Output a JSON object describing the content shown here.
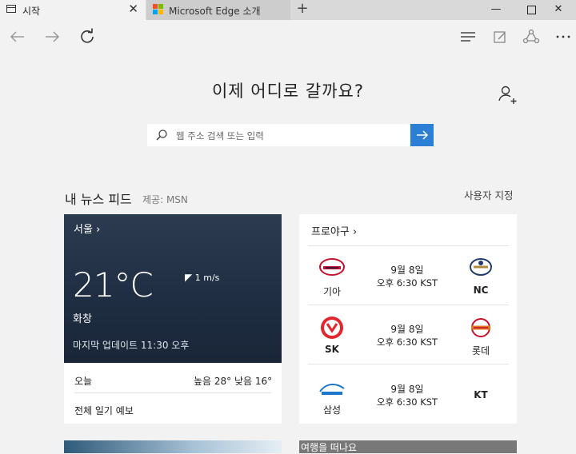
{
  "tabs": [
    {
      "label": "시작",
      "icon": "start-page-icon"
    },
    {
      "label": "Microsoft Edge 소개",
      "icon": "windows-logo-icon"
    }
  ],
  "window_controls": [
    "minimize",
    "maximize",
    "close"
  ],
  "start": {
    "heading": "이제 어디로 갈까요?",
    "search_placeholder": "웹 주소 검색 또는 입력"
  },
  "feed": {
    "title": "내 뉴스 피드",
    "provider": "제공: MSN",
    "customize": "사용자 지정"
  },
  "weather": {
    "city": "서울",
    "temperature": "21°C",
    "wind": "1 m/s",
    "condition": "화창",
    "updated": "마지막 업데이트 11:30 오후",
    "today_label": "오늘",
    "high_low": "높음 28° 낮음 16°",
    "forecast_link": "전체 일기 예보"
  },
  "baseball": {
    "title": "프로야구",
    "games": [
      {
        "home": "기아",
        "away": "NC",
        "date": "9월 8일",
        "time": "오후 6:30 KST"
      },
      {
        "home": "SK",
        "away": "롯데",
        "date": "9월 8일",
        "time": "오후 6:30 KST"
      },
      {
        "home": "삼성",
        "away": "KT",
        "date": "9월 8일",
        "time": "오후 6:30 KST"
      }
    ]
  },
  "travel_card": {
    "title": "여행을 떠나요"
  },
  "colors": {
    "accent": "#2b7fd4",
    "weather_bg": "#1f2e43"
  }
}
